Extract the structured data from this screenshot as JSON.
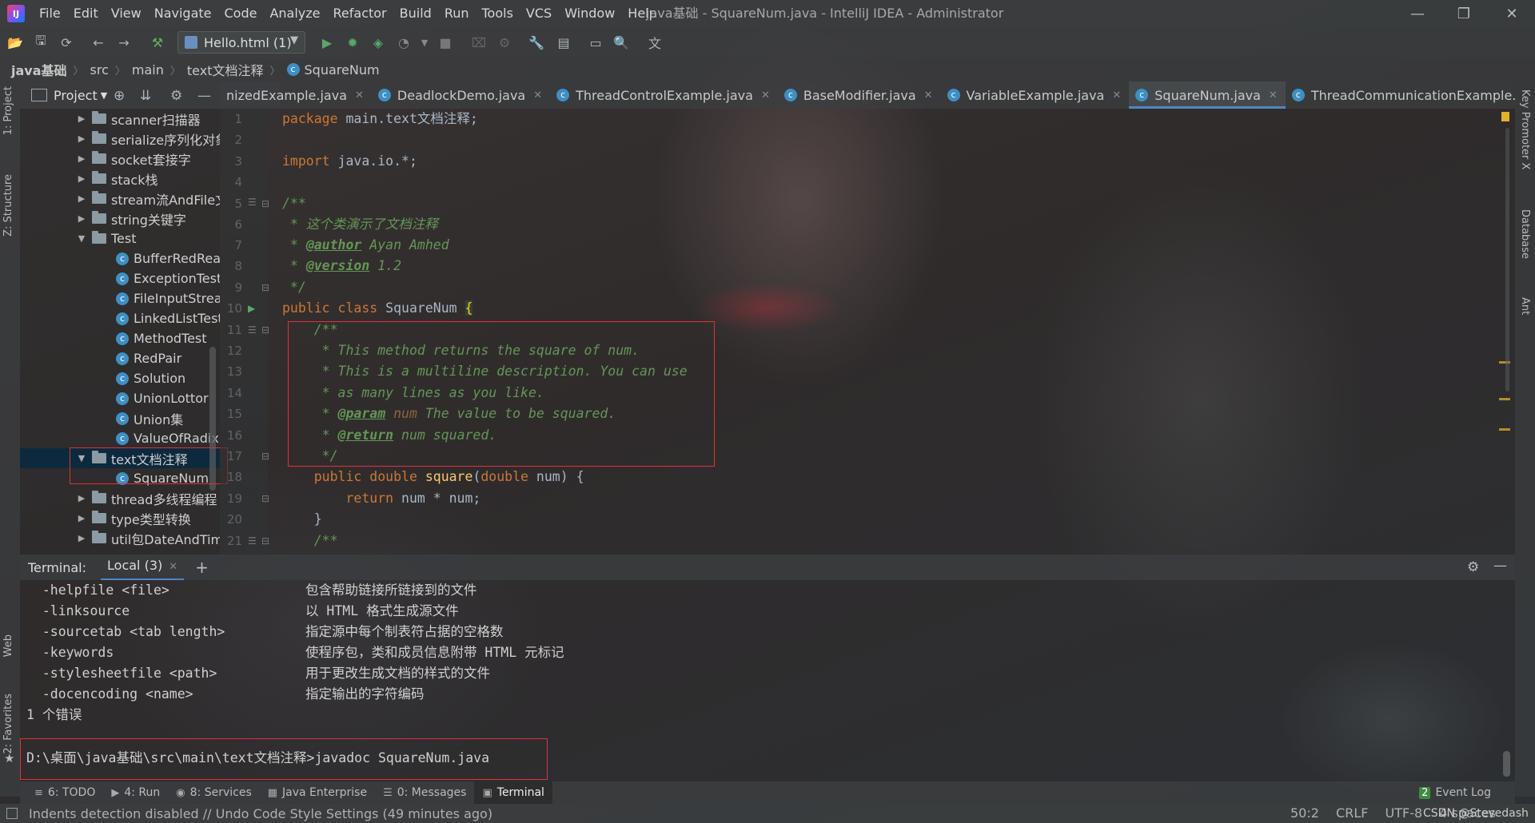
{
  "window": {
    "title": "java基础 - SquareNum.java - IntelliJ IDEA - Administrator",
    "menu": [
      "File",
      "Edit",
      "View",
      "Navigate",
      "Code",
      "Analyze",
      "Refactor",
      "Build",
      "Run",
      "Tools",
      "VCS",
      "Window",
      "Help"
    ],
    "controls": {
      "minimize": "—",
      "restore": "❐",
      "close": "✕"
    }
  },
  "toolbar": {
    "run_config": "Hello.html (1)"
  },
  "breadcrumb": [
    "java基础",
    "src",
    "main",
    "text文档注释",
    "SquareNum"
  ],
  "left_stripe": {
    "project": "1: Project",
    "structure": "Z: Structure",
    "web": "Web",
    "favorites": "2: Favorites"
  },
  "right_stripe": {
    "key_promoter": "Key Promoter X",
    "database": "Database",
    "ant": "Ant"
  },
  "project_panel": {
    "title": "Project",
    "tree": [
      {
        "label": "scanner扫描器",
        "kind": "folder",
        "state": "collapsed"
      },
      {
        "label": "serialize序列化对象",
        "kind": "folder",
        "state": "collapsed"
      },
      {
        "label": "socket套接字",
        "kind": "folder",
        "state": "collapsed"
      },
      {
        "label": "stack栈",
        "kind": "folder",
        "state": "collapsed"
      },
      {
        "label": "stream流AndFile文件",
        "kind": "folder",
        "state": "collapsed"
      },
      {
        "label": "string关键字",
        "kind": "folder",
        "state": "collapsed"
      },
      {
        "label": "Test",
        "kind": "folder",
        "state": "expanded"
      },
      {
        "label": "BufferRedRead",
        "kind": "class"
      },
      {
        "label": "ExceptionTest",
        "kind": "class"
      },
      {
        "label": "FileInputStream",
        "kind": "class"
      },
      {
        "label": "LinkedListTest",
        "kind": "class"
      },
      {
        "label": "MethodTest",
        "kind": "class"
      },
      {
        "label": "RedPair",
        "kind": "class"
      },
      {
        "label": "Solution",
        "kind": "class"
      },
      {
        "label": "UnionLottor",
        "kind": "class"
      },
      {
        "label": "Union集",
        "kind": "class"
      },
      {
        "label": "ValueOfRadix",
        "kind": "class"
      },
      {
        "label": "text文档注释",
        "kind": "folder",
        "state": "expanded",
        "selected": true
      },
      {
        "label": "SquareNum",
        "kind": "class"
      },
      {
        "label": "thread多线程编程",
        "kind": "folder",
        "state": "collapsed"
      },
      {
        "label": "type类型转换",
        "kind": "folder",
        "state": "collapsed"
      },
      {
        "label": "util包DateAndTime",
        "kind": "folder",
        "state": "collapsed"
      }
    ]
  },
  "editor_tabs": [
    {
      "label": "nizedExample.java",
      "active": false
    },
    {
      "label": "DeadlockDemo.java",
      "active": false
    },
    {
      "label": "ThreadControlExample.java",
      "active": false
    },
    {
      "label": "BaseModifier.java",
      "active": false
    },
    {
      "label": "VariableExample.java",
      "active": false
    },
    {
      "label": "SquareNum.java",
      "active": true
    },
    {
      "label": "ThreadCommunicationExample.java",
      "active": false
    },
    {
      "label": "T",
      "active": false
    }
  ],
  "line_numbers": [
    "1",
    "2",
    "3",
    "4",
    "5",
    "6",
    "7",
    "8",
    "9",
    "10",
    "11",
    "12",
    "13",
    "14",
    "15",
    "16",
    "17",
    "18",
    "19",
    "20",
    "21"
  ],
  "code": {
    "l1_kw": "package",
    "l1_rest": " main.text文档注释;",
    "l3_kw": "import",
    "l3_rest": " java.io.*;",
    "l5": "/**",
    "l6": " * 这个类演示了文档注释",
    "l7_pre": " * ",
    "l7_tag": "@author",
    "l7_rest": " Ayan Amhed",
    "l8_pre": " * ",
    "l8_tag": "@version",
    "l8_rest": " 1.2",
    "l9": " */",
    "l10_kw": "public class",
    "l10_name": " SquareNum ",
    "l10_brace": "{",
    "l11": "    /**",
    "l12": "     * This method returns the square of num.",
    "l13": "     * This is a multiline description. You can use",
    "l14": "     * as many lines as you like.",
    "l15_pre": "     * ",
    "l15_tag": "@param",
    "l15_param": " num",
    "l15_rest": " The value to be squared.",
    "l16_pre": "     * ",
    "l16_tag": "@return",
    "l16_rest": " num squared.",
    "l17": "     */",
    "l18_kw": "    public double",
    "l18_fn": " square",
    "l18_open": "(",
    "l18_kw2": "double",
    "l18_rest": " num) {",
    "l19_kw": "        return",
    "l19_rest": " num * num;",
    "l20": "    }",
    "l21": "    /**"
  },
  "terminal": {
    "label": "Terminal:",
    "session": "Local (3)",
    "options": [
      {
        "opt": "  -helpfile <file>",
        "desc": "包含帮助链接所链接到的文件"
      },
      {
        "opt": "  -linksource",
        "desc": "以 HTML 格式生成源文件"
      },
      {
        "opt": "  -sourcetab <tab length>",
        "desc": "指定源中每个制表符占据的空格数"
      },
      {
        "opt": "  -keywords",
        "desc": "使程序包，类和成员信息附带 HTML 元标记"
      },
      {
        "opt": "  -stylesheetfile <path>",
        "desc": "用于更改生成文档的样式的文件"
      },
      {
        "opt": "  -docencoding <name>",
        "desc": "指定输出的字符编码"
      }
    ],
    "error": "1 个错误",
    "prompt": "D:\\桌面\\java基础\\src\\main\\text文档注释>javadoc SquareNum.java"
  },
  "bottom_tabs": [
    {
      "label": "6: TODO",
      "icon": "≡"
    },
    {
      "label": "4: Run",
      "icon": "▶"
    },
    {
      "label": "8: Services",
      "icon": "◉"
    },
    {
      "label": "Java Enterprise",
      "icon": "▦"
    },
    {
      "label": "0: Messages",
      "icon": "☰"
    },
    {
      "label": "Terminal",
      "icon": "▣"
    }
  ],
  "event_log": "Event Log",
  "event_count": "2",
  "status": {
    "message": "Indents detection disabled // Undo   Code Style Settings (49 minutes ago)",
    "position": "50:2",
    "line_sep": "CRLF",
    "encoding": "UTF-8",
    "indent": "4 spaces",
    "watermark": "CSDN @Stevedash"
  }
}
